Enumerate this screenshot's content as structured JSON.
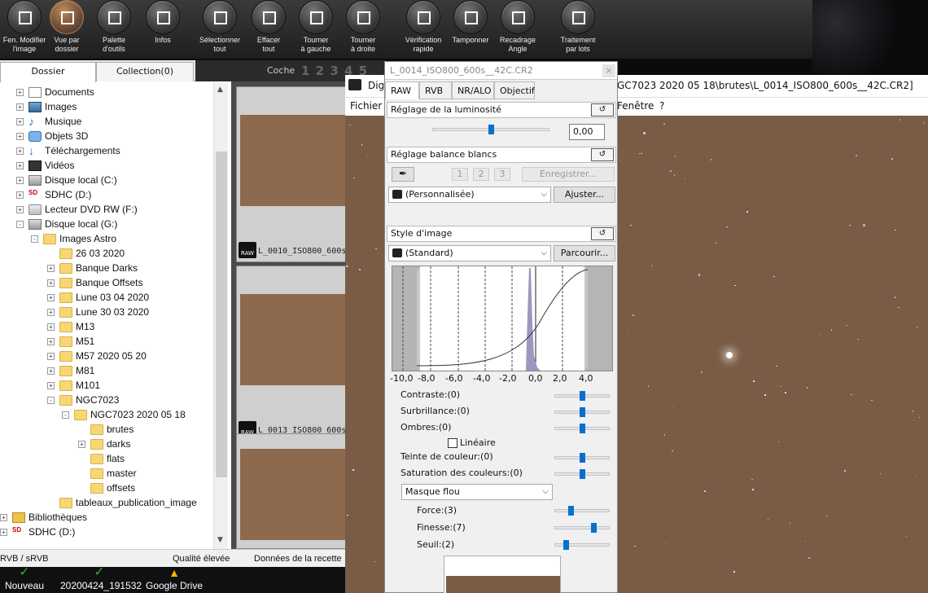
{
  "toolbar": {
    "buttons": [
      {
        "label1": "Fen. Modifier",
        "label2": "l'image",
        "icon": "edit-image-icon"
      },
      {
        "label1": "Vue par",
        "label2": "dossier",
        "icon": "folder-view-icon"
      },
      {
        "label1": "Palette",
        "label2": "d'outils",
        "icon": "tool-palette-icon"
      },
      {
        "label1": "Infos",
        "label2": "",
        "icon": "info-icon"
      },
      {
        "label1": "Sélectionner",
        "label2": "tout",
        "icon": "select-all-icon"
      },
      {
        "label1": "Effacer",
        "label2": "tout",
        "icon": "clear-all-icon"
      },
      {
        "label1": "Tourner",
        "label2": "à gauche",
        "icon": "rotate-left-icon"
      },
      {
        "label1": "Tourner",
        "label2": "à droite",
        "icon": "rotate-right-icon"
      },
      {
        "label1": "Vérification",
        "label2": "rapide",
        "icon": "quick-check-icon"
      },
      {
        "label1": "Tamponner",
        "label2": "",
        "icon": "stamp-icon"
      },
      {
        "label1": "Recadrage",
        "label2": "Angle",
        "icon": "crop-angle-icon"
      },
      {
        "label1": "Traitement",
        "label2": "par lots",
        "icon": "batch-icon"
      }
    ]
  },
  "left": {
    "tab_folder": "Dossier",
    "tab_collection": "Collection(0)",
    "tree": [
      {
        "label": "Documents",
        "icon": "docs"
      },
      {
        "label": "Images",
        "icon": "pics"
      },
      {
        "label": "Musique",
        "icon": "music"
      },
      {
        "label": "Objets 3D",
        "icon": "obj3d"
      },
      {
        "label": "Téléchargements",
        "icon": "dl"
      },
      {
        "label": "Vidéos",
        "icon": "vid"
      },
      {
        "label": "Disque local (C:)",
        "icon": "drive"
      },
      {
        "label": "SDHC (D:)",
        "icon": "sd"
      },
      {
        "label": "Lecteur DVD RW (F:)",
        "icon": "dvd"
      },
      {
        "label": "Disque local (G:)",
        "icon": "drive"
      },
      {
        "label": "Images Astro",
        "icon": "folder"
      },
      {
        "label": "26 03 2020",
        "icon": "folder"
      },
      {
        "label": "Banque Darks",
        "icon": "folder"
      },
      {
        "label": "Banque Offsets",
        "icon": "folder"
      },
      {
        "label": "Lune 03 04 2020",
        "icon": "folder"
      },
      {
        "label": "Lune 30 03 2020",
        "icon": "folder"
      },
      {
        "label": "M13",
        "icon": "folder"
      },
      {
        "label": "M51",
        "icon": "folder"
      },
      {
        "label": "M57 2020 05 20",
        "icon": "folder"
      },
      {
        "label": "M81",
        "icon": "folder"
      },
      {
        "label": "M101",
        "icon": "folder"
      },
      {
        "label": "NGC7023",
        "icon": "folder"
      },
      {
        "label": "NGC7023 2020 05 18",
        "icon": "folder"
      },
      {
        "label": "brutes",
        "icon": "folder"
      },
      {
        "label": "darks",
        "icon": "folder"
      },
      {
        "label": "flats",
        "icon": "folder"
      },
      {
        "label": "master",
        "icon": "folder"
      },
      {
        "label": "offsets",
        "icon": "folder"
      },
      {
        "label": "tableaux_publication_image",
        "icon": "folder"
      },
      {
        "label": "Bibliothèques",
        "icon": "lib"
      },
      {
        "label": "SDHC (D:)",
        "icon": "sd"
      }
    ]
  },
  "strip": {
    "header_label": "Coche",
    "header_nums": "1 2 3 4 5",
    "thumb1_name": "L_0010_ISO800_600s",
    "thumb2_name": "L_0013_ISO800_600s",
    "raw_badge": "RAW"
  },
  "main": {
    "title": "GC7023 2020 05 18\\brutes\\L_0014_ISO800_600s__42C.CR2]",
    "title_prefix": "Digi",
    "menu_file": "Fichier",
    "menu_window": "Fenêtre",
    "menu_help": "?"
  },
  "palette": {
    "title": "L_0014_ISO800_600s__42C.CR2",
    "close": "×",
    "tabs": [
      "RAW",
      "RVB",
      "NR/ALO",
      "Objectif"
    ],
    "brightness_header": "Réglage de la luminosité",
    "brightness_value": "0,00",
    "brightness_level": 0.5,
    "wb_header": "Réglage balance blancs",
    "wb_buttons": [
      "1",
      "2",
      "3"
    ],
    "register_label": "Enregistrer...",
    "wb_combo": "(Personnalisée)",
    "adjust_label": "Ajuster...",
    "style_header": "Style d'image",
    "style_combo": "(Standard)",
    "browse_label": "Parcourir...",
    "axis_ticks": [
      "-10,0",
      "-8,0",
      "-6,0",
      "-4,0",
      "-2,0",
      "0,0",
      "2,0",
      "4,0"
    ],
    "sliders": [
      {
        "label": "Contraste:(0)",
        "level": 0.5
      },
      {
        "label": "Surbrillance:(0)",
        "level": 0.5
      },
      {
        "label": "Ombres:(0)",
        "level": 0.5
      },
      {
        "label": "Teinte de couleur:(0)",
        "level": 0.5
      },
      {
        "label": "Saturation des couleurs:(0)",
        "level": 0.5
      }
    ],
    "linear_label": "Linéaire",
    "unsharp_combo": "Masque flou",
    "sharp_sliders": [
      {
        "label": "Force:(3)",
        "level": 0.3
      },
      {
        "label": "Finesse:(7)",
        "level": 0.7
      },
      {
        "label": "Seuil:(2)",
        "level": 0.2
      }
    ]
  },
  "status": {
    "space": "RVB / sRVB",
    "quality": "Qualité élevée",
    "recipe": "Données de la recette"
  },
  "desktop": {
    "items": [
      "Nouveau",
      "20200424_191532",
      "Google Drive"
    ]
  }
}
